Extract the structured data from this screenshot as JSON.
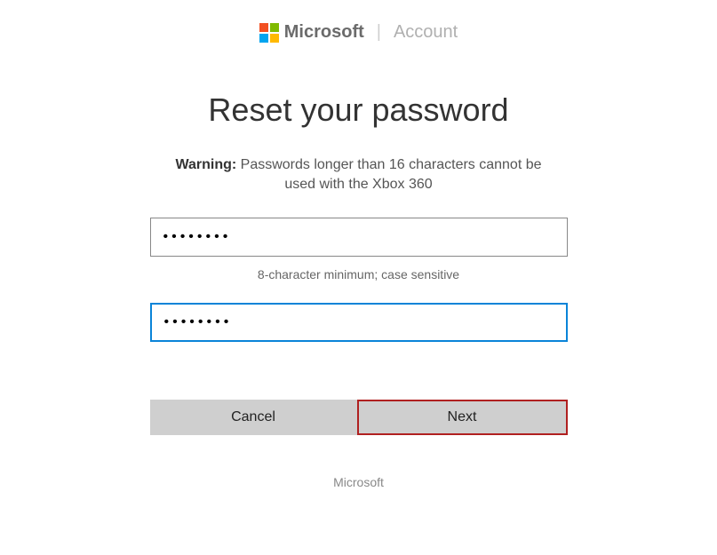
{
  "header": {
    "brand": "Microsoft",
    "section": "Account"
  },
  "page": {
    "title": "Reset your password",
    "warning_label": "Warning:",
    "warning_text": " Passwords longer than 16 characters cannot be used with the Xbox 360",
    "password_value": "••••••••",
    "password_hint": "8-character minimum; case sensitive",
    "confirm_value": "••••••••",
    "cancel_label": "Cancel",
    "next_label": "Next"
  },
  "footer": {
    "text": "Microsoft"
  },
  "colors": {
    "focus_border": "#0a84d8",
    "primary_border": "#b02020",
    "button_bg": "#cfcfcf"
  }
}
